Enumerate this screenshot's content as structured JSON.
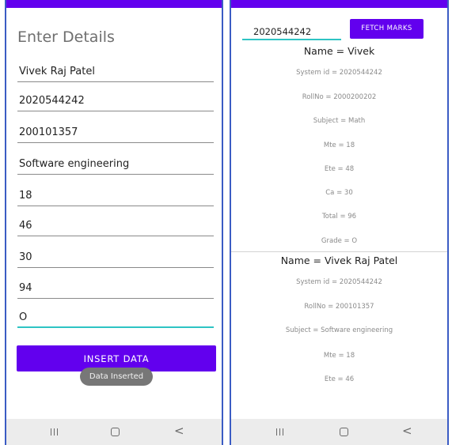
{
  "left_screen": {
    "title": "Enter Details",
    "fields": [
      {
        "value": "Vivek Raj Patel"
      },
      {
        "value": "2020544242"
      },
      {
        "value": "200101357"
      },
      {
        "value": "Software engineering"
      },
      {
        "value": "18"
      },
      {
        "value": "46"
      },
      {
        "value": "30"
      },
      {
        "value": "94"
      },
      {
        "value": "O"
      }
    ],
    "insert_button": "INSERT DATA",
    "toast": "Data Inserted"
  },
  "right_screen": {
    "search_value": "2020544242",
    "fetch_button": "FETCH MARKS",
    "records": [
      {
        "name": "Name = Vivek",
        "lines": [
          "System id = 2020544242",
          "RollNo = 2000200202",
          "Subject = Math",
          "Mte = 18",
          "Ete = 48",
          "Ca = 30",
          "Total = 96",
          "Grade = O"
        ]
      },
      {
        "name": "Name = Vivek Raj Patel",
        "lines": [
          "System id = 2020544242",
          "RollNo = 200101357",
          "Subject = Software engineering",
          "Mte = 18",
          "Ete = 46"
        ]
      }
    ]
  },
  "navbar": {
    "icons": [
      "recent-apps-icon",
      "home-icon",
      "back-icon"
    ],
    "back_glyph": "<"
  },
  "colors": {
    "accent": "#6200ee",
    "focus_underline": "#2ec4c4",
    "frame_border": "#3b5cc4",
    "toast_bg": "#777777"
  }
}
